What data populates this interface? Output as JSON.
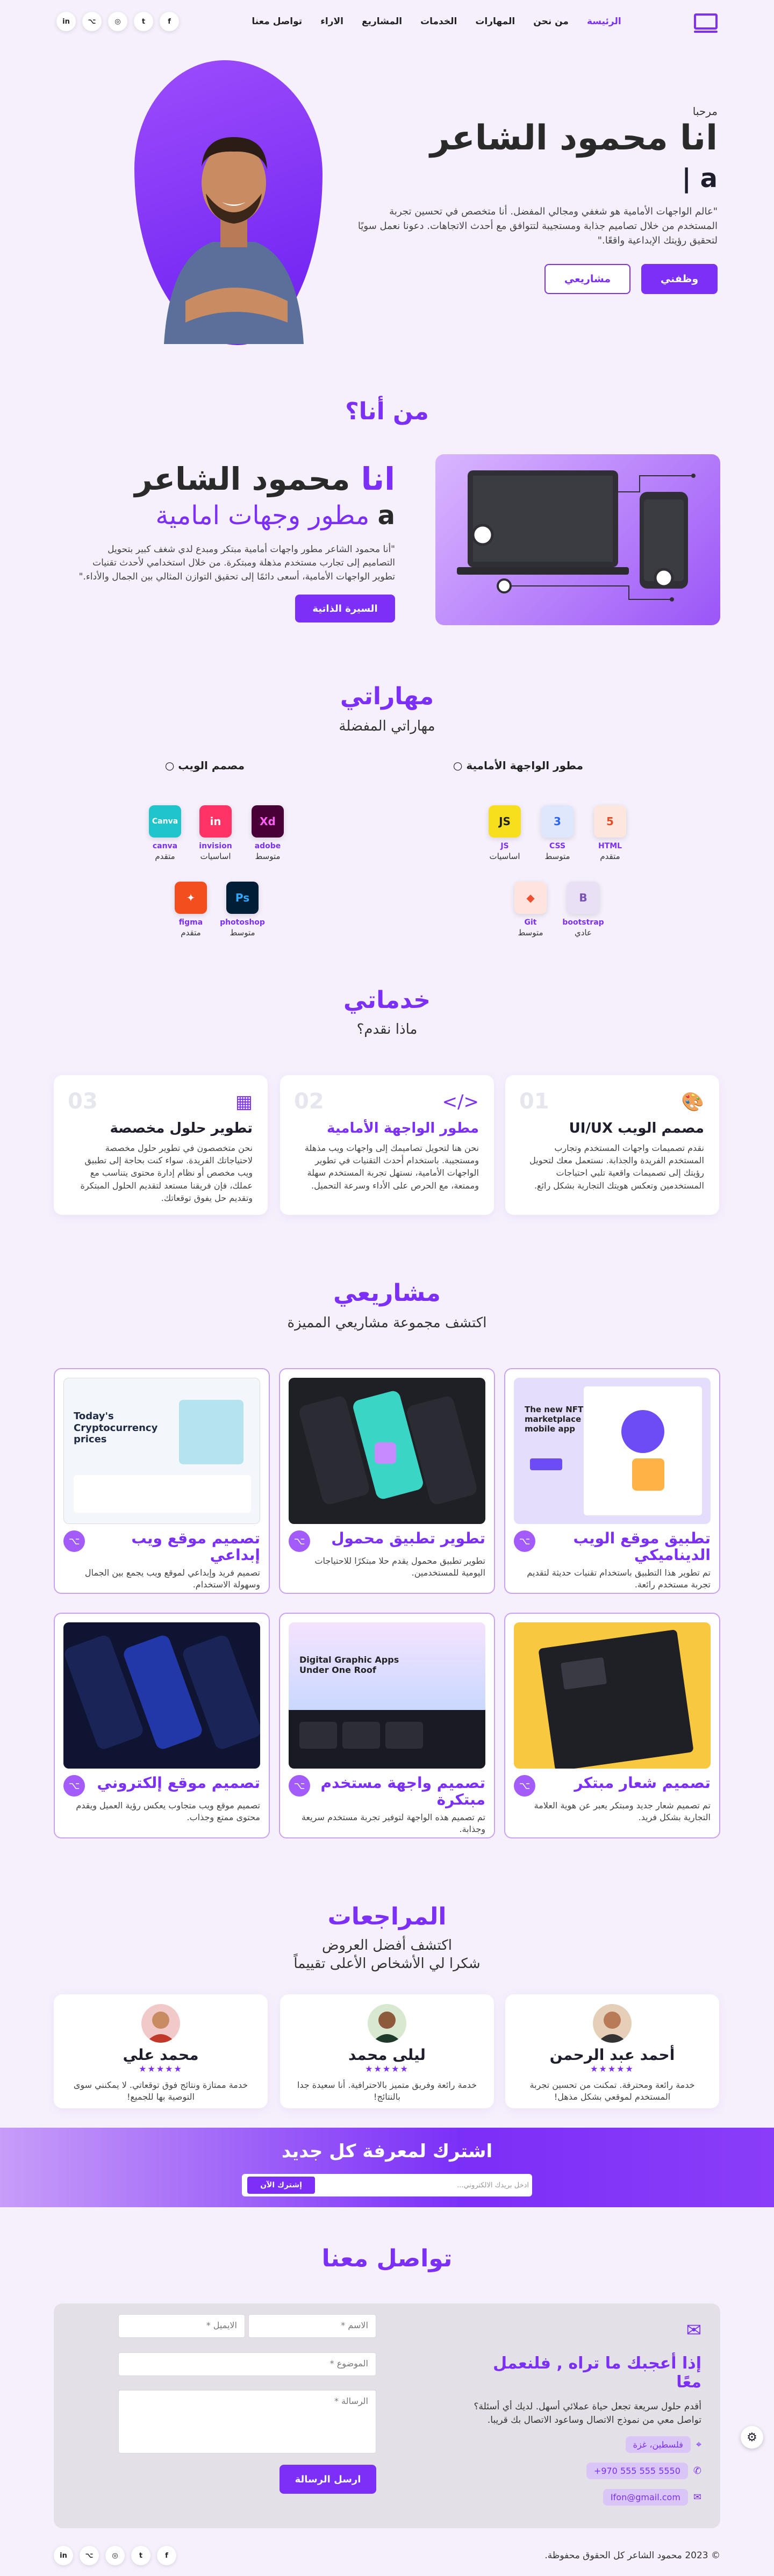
{
  "nav": {
    "items": [
      "الرئيسة",
      "من نحن",
      "المهارات",
      "الخدمات",
      "المشاريع",
      "الاراء",
      "تواصل معنا"
    ],
    "social": [
      "f",
      "t",
      "◎",
      "⌥",
      "in"
    ]
  },
  "hero": {
    "greeting": "مرحبا",
    "name": "انا محمود الشاعر",
    "typed": "a |",
    "description": "\"عالم الواجهات الأمامية هو شغفي ومجالي المفضل. أنا متخصص في تحسين تجربة المستخدم من خلال تصاميم جذابة ومستجيبة لتتوافق مع أحدث الاتجاهات. دعونا نعمل سويًا لتحقيق رؤيتك الإبداعية واقعًا.\"",
    "hire_label": "وظفني",
    "projects_label": "مشاريعي"
  },
  "about": {
    "title": "من أنا؟",
    "name_prefix": "انا",
    "name": "محمود الشاعر",
    "role_prefix": "a",
    "role": "مطور وجهات امامية",
    "description": "\"أنا محمود الشاعر مطور واجهات أمامية مبتكر ومبدع لدي شغف كبير بتحويل التصاميم إلى تجارب مستخدم مذهلة ومبتكرة. من خلال استخدامي لأحدث تقنيات تطوير الواجهات الأمامية، أسعى دائمًا إلى تحقيق التوازن المثالي بين الجمال والأداء.\"",
    "cv_label": "السيرة الذاتية"
  },
  "skills": {
    "title": "مهاراتي",
    "subtitle": "مهاراتي المفضلة",
    "frontend_title": "مطور الواجهة الأمامية",
    "design_title": "مصمم الويب",
    "frontend": [
      {
        "name": "HTML",
        "level": "متقدم",
        "icon": "html5-icon",
        "glyph": "5",
        "color": "#e44d26",
        "bg": "#fde6de"
      },
      {
        "name": "CSS",
        "level": "متوسط",
        "icon": "css3-icon",
        "glyph": "3",
        "color": "#2965f1",
        "bg": "#dfe7fd"
      },
      {
        "name": "JS",
        "level": "اساسيات",
        "icon": "js-icon",
        "glyph": "JS",
        "color": "#222",
        "bg": "#f7df1e"
      },
      {
        "name": "bootstrap",
        "level": "عادي",
        "icon": "bootstrap-icon",
        "glyph": "B",
        "color": "#7952b3",
        "bg": "#e9e0f6"
      },
      {
        "name": "Git",
        "level": "متوسط",
        "icon": "git-icon",
        "glyph": "◆",
        "color": "#f05032",
        "bg": "#fde4de"
      }
    ],
    "design": [
      {
        "name": "adobe",
        "level": "متوسط",
        "icon": "adobe-xd-icon",
        "glyph": "Xd",
        "color": "#ff61f6",
        "bg": "#470137"
      },
      {
        "name": "invision",
        "level": "اساسيات",
        "icon": "invision-icon",
        "glyph": "in",
        "color": "#fff",
        "bg": "#ff3366"
      },
      {
        "name": "canva",
        "level": "متقدم",
        "icon": "canva-icon",
        "glyph": "Canva",
        "color": "#fff",
        "bg": "#20c4cb"
      },
      {
        "name": "photoshop",
        "level": "متوسط",
        "icon": "photoshop-icon",
        "glyph": "Ps",
        "color": "#31a8ff",
        "bg": "#001e36"
      },
      {
        "name": "figma",
        "level": "متقدم",
        "icon": "figma-icon",
        "glyph": "✦",
        "color": "#fff",
        "bg": "#f24e1e"
      }
    ]
  },
  "services": {
    "title": "خدماتي",
    "subtitle": "ماذا نقدم؟",
    "items": [
      {
        "num": "01",
        "icon": "palette-icon",
        "glyph": "🎨",
        "title": "مصمم الويب UI/UX",
        "desc": "نقدم تصميمات واجهات المستخدم وتجارب المستخدم الفريدة والجذابة. نستعمل معك لتحويل رؤيتك إلى تصميمات واقعية تلبي احتياجات المستخدمين وتعكس هويتك التجارية بشكل رائع."
      },
      {
        "num": "02",
        "icon": "code-icon",
        "glyph": "</>",
        "title": "مطور الواجهة الأمامية",
        "desc": "نحن هنا لتحويل تصاميمك إلى واجهات ويب مذهلة ومستجيبة. باستخدام أحدث التقنيات في تطوير الواجهات الأمامية، نستهل تجربة المستخدم سهلة وممتعة، مع الحرص على الأداء وسرعة التحميل."
      },
      {
        "num": "03",
        "icon": "building-icon",
        "glyph": "▦",
        "title": "تطوير حلول مخصصة",
        "desc": "نحن متخصصون في تطوير حلول مخصصة لاحتياجاتك الفريدة. سواء كنت بحاجة إلى تطبيق ويب مخصص أو نظام إدارة محتوى يتناسب مع عملك، فإن فريقنا مستعد لتقديم الحلول المبتكرة وتقديم حل يفوق توقعاتك."
      }
    ]
  },
  "projects": {
    "title": "مشاريعي",
    "subtitle": "اكتشف مجموعة مشاريعي المميزة",
    "items": [
      {
        "title": "تطبيق موقع الويب الديناميكي",
        "desc": "تم تطوير هذا التطبيق باستخدام تقنيات حديثة لتقديم تجربة مستخدم رائعة.",
        "theme": "light"
      },
      {
        "title": "تطوير تطبيق محمول",
        "desc": "تطوير تطبيق محمول يقدم حلا مبتكرًا للاحتياجات اليومية للمستخدمين.",
        "theme": "dark"
      },
      {
        "title": "تصميم موقع ويب إبداعي",
        "desc": "تصميم فريد وإبداعي لموقع ويب يجمع بين الجمال وسهولة الاستخدام.",
        "theme": "crypto"
      },
      {
        "title": "تصميم شعار مبتكر",
        "desc": "تم تصميم شعار جديد ومبتكر يعبر عن هوية العلامة التجارية بشكل فريد.",
        "theme": "yellow"
      },
      {
        "title": "تصميم واجهة مستخدم مبتكرة",
        "desc": "تم تصميم هذه الواجهة لتوفير تجربة مستخدم سريعة وجذابة.",
        "theme": "gradient"
      },
      {
        "title": "تصميم موقع إلكتروني",
        "desc": "تصميم موقع ويب متجاوب يعكس رؤية العميل ويقدم محتوى ممتع وجذاب.",
        "theme": "navy"
      }
    ],
    "mock": {
      "crypto_heading": "Today's Cryptocurrency prices",
      "nft_heading": "The new NFT marketplace mobile app",
      "digital_heading": "Digital Graphic Apps Under One Roof"
    }
  },
  "testimonials": {
    "title": "المراجعات",
    "subtitle": "اكتشف أفضل العروض",
    "subtitle2": "شكرا لي الأشخاص الأعلى تقييماً",
    "items": [
      {
        "name": "أحمد عبد الرحمن",
        "stars": "★★★★★",
        "text": "خدمة رائعة ومحترفة. تمكنت من تحسين تجربة المستخدم لموقعي بشكل مذهل!",
        "skin": "#b97a57"
      },
      {
        "name": "ليلى محمد",
        "stars": "★★★★★",
        "text": "خدمة رائعة وفريق متميز بالاحترافية. أنا سعيدة جدا بالنتائج!",
        "skin": "#8d5a3b"
      },
      {
        "name": "محمد علي",
        "stars": "★★★★★",
        "text": "خدمة ممتازة ونتائج فوق توقعاتي. لا يمكنني سوى التوصية بها للجميع!",
        "skin": "#c98b62"
      }
    ]
  },
  "newsletter": {
    "title": "اشترك لمعرفة كل جديد",
    "placeholder": "ادخل بريدك الالكتروني...",
    "button": "إشترك الآن"
  },
  "contact": {
    "title": "تواصل معنا",
    "name_placeholder": "الاسم *",
    "email_placeholder": "الايميل *",
    "subject_placeholder": "الموضوع *",
    "message_placeholder": "الرسالة *",
    "send_label": "ارسل الرسالة",
    "info_title": "إذا أعجبك ما تراه , فلنعمل معًا",
    "info_desc": "أقدم حلول سريعة تجعل حياة عملائي أسهل. لديك أي أسئلة؟ تواصل معي من نموذج الاتصال وساعود الاتصال بك قريبا.",
    "location": "فلسطين، غزة",
    "phone": "+970 555 555 5550",
    "email": "Ifon@gmail.com"
  },
  "footer": {
    "copyright": "© 2023 محمود الشاعر كل الحقوق محفوظة."
  }
}
